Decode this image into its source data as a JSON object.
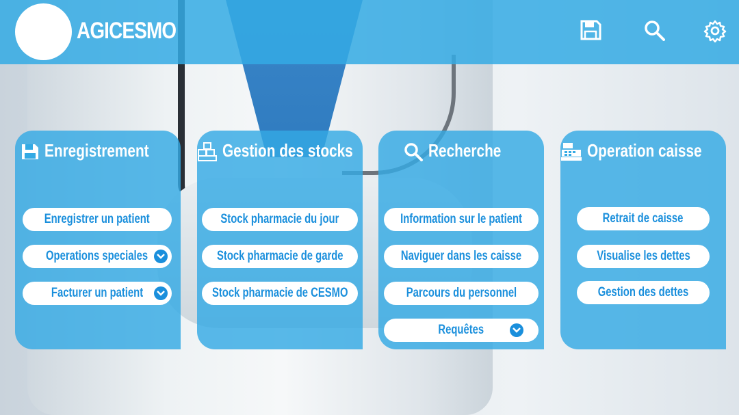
{
  "app": {
    "brand": "AGICESMO"
  },
  "header": {
    "icons": [
      "save-icon",
      "search-icon",
      "gear-icon"
    ]
  },
  "colors": {
    "accent": "#34aae4",
    "button_text": "#1a8fdc",
    "text_light": "#ffffff"
  },
  "cards": [
    {
      "title": "Enregistrement",
      "icon": "save-icon",
      "buttons": [
        {
          "label": "Enregistrer un patient",
          "dropdown": false
        },
        {
          "label": "Operations speciales",
          "dropdown": true
        },
        {
          "label": "Facturer un patient",
          "dropdown": true
        }
      ]
    },
    {
      "title": "Gestion des stocks",
      "icon": "boxes-icon",
      "buttons": [
        {
          "label": "Stock pharmacie du jour",
          "dropdown": false
        },
        {
          "label": "Stock pharmacie de garde",
          "dropdown": false
        },
        {
          "label": "Stock pharmacie de CESMO",
          "dropdown": false
        }
      ]
    },
    {
      "title": "Recherche",
      "icon": "search-icon",
      "buttons": [
        {
          "label": "Information sur le patient",
          "dropdown": false
        },
        {
          "label": "Naviguer dans les caisse",
          "dropdown": false
        },
        {
          "label": "Parcours du personnel",
          "dropdown": false
        },
        {
          "label": "Requêtes",
          "dropdown": true
        }
      ]
    },
    {
      "title": "Operation caisse",
      "icon": "cash-register-icon",
      "buttons": [
        {
          "label": "Retrait de caisse",
          "dropdown": false
        },
        {
          "label": "Visualise les dettes",
          "dropdown": false
        },
        {
          "label": "Gestion des dettes",
          "dropdown": false
        }
      ]
    }
  ]
}
